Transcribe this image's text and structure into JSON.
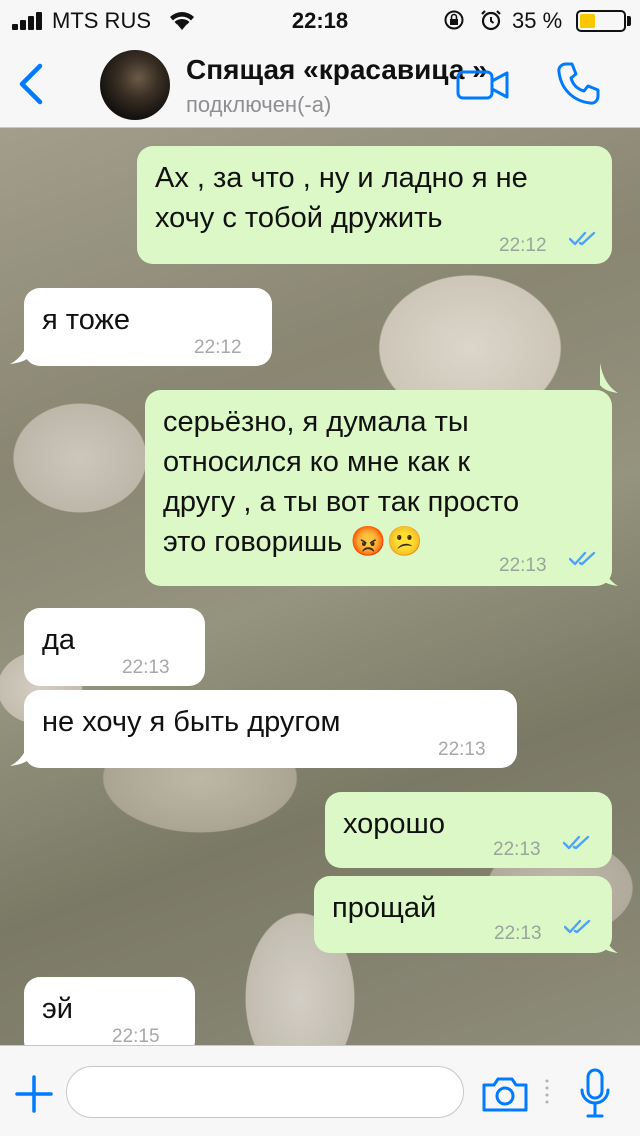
{
  "status_bar": {
    "carrier": "MTS RUS",
    "time": "22:18",
    "battery_percent": "35 %",
    "battery_level": 0.35,
    "icons": [
      "signal-icon",
      "wifi-icon",
      "orientation-lock-icon",
      "alarm-icon",
      "battery-icon"
    ]
  },
  "header": {
    "contact_name": "Спящая «красавица »",
    "contact_status": "подключен(-а)",
    "icons": [
      "back-chevron-icon",
      "video-call-icon",
      "phone-call-icon"
    ]
  },
  "messages": [
    {
      "direction": "out",
      "text": "Ах , за что , ну и ладно я не\nхочу с тобой дружить",
      "time": "22:12",
      "read": true
    },
    {
      "direction": "in",
      "text": "я тоже",
      "time": "22:12"
    },
    {
      "direction": "out",
      "text": "серьёзно, я думала ты\nотносился ко мне как к\nдругу , а ты вот так просто\nэто говоришь 😡😕",
      "time": "22:13",
      "read": true
    },
    {
      "direction": "in",
      "text": "да",
      "time": "22:13"
    },
    {
      "direction": "in",
      "text": "не хочу я быть другом",
      "time": "22:13"
    },
    {
      "direction": "out",
      "text": "хорошо",
      "time": "22:13",
      "read": true
    },
    {
      "direction": "out",
      "text": "прощай",
      "time": "22:13",
      "read": true
    },
    {
      "direction": "in",
      "text": "эй",
      "time": "22:15"
    }
  ],
  "input_bar": {
    "placeholder": "",
    "icons": [
      "plus-icon",
      "camera-icon",
      "microphone-icon"
    ]
  },
  "colors": {
    "accent": "#007aff",
    "outgoing_bubble": "#dcf8c6",
    "incoming_bubble": "#ffffff",
    "read_ticks": "#4fa3f7"
  }
}
